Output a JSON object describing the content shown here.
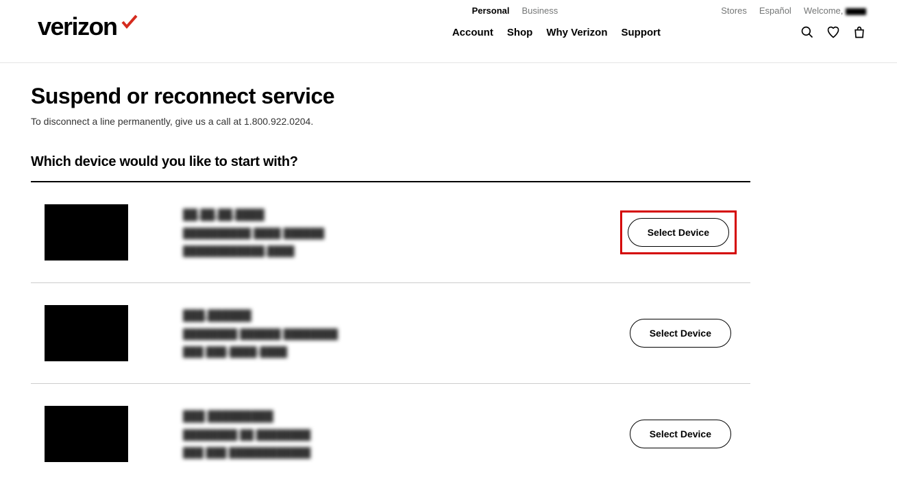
{
  "header": {
    "logo_text": "verizon",
    "top_links": {
      "personal": "Personal",
      "business": "Business",
      "stores": "Stores",
      "espanol": "Español",
      "welcome": "Welcome,"
    },
    "main_nav": {
      "account": "Account",
      "shop": "Shop",
      "why_verizon": "Why Verizon",
      "support": "Support"
    }
  },
  "page": {
    "title": "Suspend or reconnect service",
    "subtitle": "To disconnect a line permanently, give us a call at 1.800.922.0204.",
    "section_title": "Which device would you like to start with?",
    "select_button": "Select Device"
  },
  "devices": [
    {
      "name": "██.██.██.████",
      "line2": "██████████ ████ ██████",
      "line3": "████████████.████"
    },
    {
      "name": "███.██████",
      "line2": "████████ ██████ ████████",
      "line3": "███ ███-████-████"
    },
    {
      "name": "███ █████████",
      "line2": "████████ ██ ████████",
      "line3": "███ ███ ████████████"
    }
  ]
}
